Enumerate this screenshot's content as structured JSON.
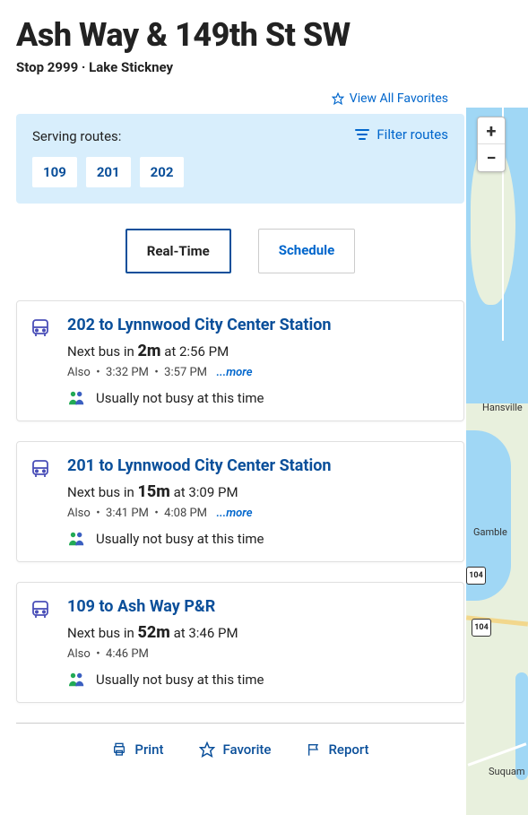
{
  "header": {
    "title": "Ash Way & 149th St SW",
    "subtitle": "Stop 2999 · Lake Stickney",
    "view_all_favorites": "View All Favorites"
  },
  "serving": {
    "label": "Serving routes:",
    "filter_label": "Filter routes",
    "routes": [
      "109",
      "201",
      "202"
    ]
  },
  "tabs": {
    "realtime": "Real-Time",
    "schedule": "Schedule"
  },
  "routes": [
    {
      "title": "202 to Lynnwood City Center Station",
      "next_prefix": "Next bus in ",
      "next_bold": "2m",
      "next_suffix": " at 2:56 PM",
      "also_label": "Also",
      "also_times": [
        "3:32 PM",
        "3:57 PM"
      ],
      "more": "...more",
      "busy": "Usually not busy at this time"
    },
    {
      "title": "201 to Lynnwood City Center Station",
      "next_prefix": "Next bus in ",
      "next_bold": "15m",
      "next_suffix": " at 3:09 PM",
      "also_label": "Also",
      "also_times": [
        "3:41 PM",
        "4:08 PM"
      ],
      "more": "...more",
      "busy": "Usually not busy at this time"
    },
    {
      "title": "109 to Ash Way P&R",
      "next_prefix": "Next bus in ",
      "next_bold": "52m",
      "next_suffix": " at 3:46 PM",
      "also_label": "Also",
      "also_times": [
        "4:46 PM"
      ],
      "more": "",
      "busy": "Usually not busy at this time"
    }
  ],
  "actions": {
    "print": "Print",
    "favorite": "Favorite",
    "report": "Report"
  },
  "map": {
    "labels": {
      "hansville": "Hansville",
      "gamble": "Gamble",
      "suquam": "Suquam"
    },
    "shields": {
      "r104a": "104",
      "r104b": "104"
    },
    "zoom_in": "+",
    "zoom_out": "−"
  }
}
